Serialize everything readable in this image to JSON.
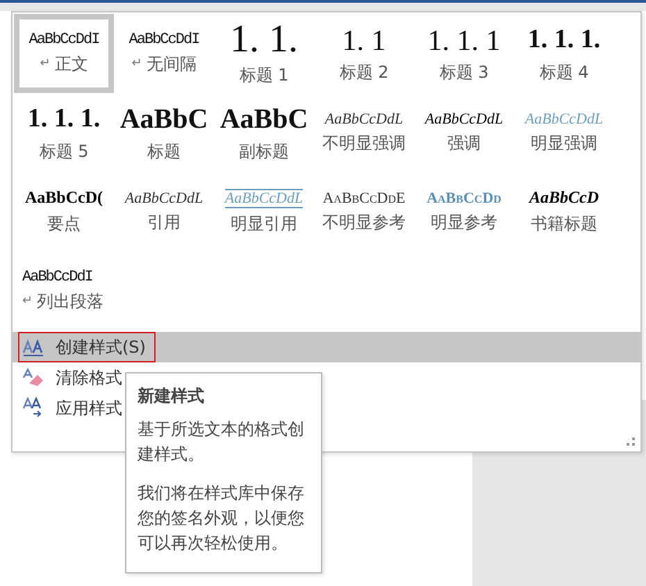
{
  "style_gallery": [
    {
      "preview": "AaBbCcDdI",
      "kind": "plain",
      "paragraph_mark": "↵",
      "label": "正文",
      "selected": true
    },
    {
      "preview": "AaBbCcDdI",
      "kind": "plain",
      "paragraph_mark": "↵",
      "label": "无间隔",
      "selected": false
    },
    {
      "preview": "1. 1.",
      "kind": "heading-large",
      "label": "标题 1",
      "selected": false
    },
    {
      "preview": "1. 1",
      "kind": "heading",
      "label": "标题 2",
      "selected": false
    },
    {
      "preview": "1. 1. 1",
      "kind": "heading",
      "label": "标题 3",
      "selected": false
    },
    {
      "preview": "1. 1. 1.",
      "kind": "heading-bold",
      "label": "标题 4",
      "selected": false
    },
    {
      "preview": "1. 1. 1.",
      "kind": "heading-bold",
      "label": "标题 5",
      "selected": false
    },
    {
      "preview": "AaBbC",
      "kind": "title",
      "label": "标题",
      "selected": false
    },
    {
      "preview": "AaBbC",
      "kind": "title",
      "label": "副标题",
      "selected": false
    },
    {
      "preview": "AaBbCcDdL",
      "kind": "italic",
      "label": "不明显强调",
      "selected": false
    },
    {
      "preview": "AaBbCcDdL",
      "kind": "italic-dark",
      "label": "强调",
      "selected": false
    },
    {
      "preview": "AaBbCcDdL",
      "kind": "italic-blue",
      "label": "明显强调",
      "selected": false
    },
    {
      "preview": "AaBbCcD(",
      "kind": "bold",
      "label": "要点",
      "selected": false
    },
    {
      "preview": "AaBbCcDdL",
      "kind": "italic",
      "label": "引用",
      "selected": false
    },
    {
      "preview": "AaBbCcDdL",
      "kind": "italic-blue-underlined",
      "label": "明显引用",
      "selected": false
    },
    {
      "preview": "AaBbCcDdE",
      "kind": "smallcaps",
      "label": "不明显参考",
      "selected": false
    },
    {
      "preview": "AaBbCcDd",
      "kind": "smallcaps-blue",
      "label": "明显参考",
      "selected": false
    },
    {
      "preview": "AaBbCcD",
      "kind": "bold-italic",
      "label": "书籍标题",
      "selected": false
    },
    {
      "preview": "AaBbCcDdI",
      "kind": "plain",
      "paragraph_mark": "↵",
      "label": "列出段落",
      "selected": false
    }
  ],
  "menu_items": [
    {
      "label": "创建样式(S)",
      "selected": true
    },
    {
      "label": "清除格式",
      "selected": false
    },
    {
      "label": "应用样式",
      "selected": false
    }
  ],
  "tooltip": {
    "title": "新建样式",
    "paragraphs": [
      "基于所选文本的格式创建样式。",
      "我们将在样式库中保存您的签名外观，以便您可以再次轻松使用。"
    ]
  }
}
